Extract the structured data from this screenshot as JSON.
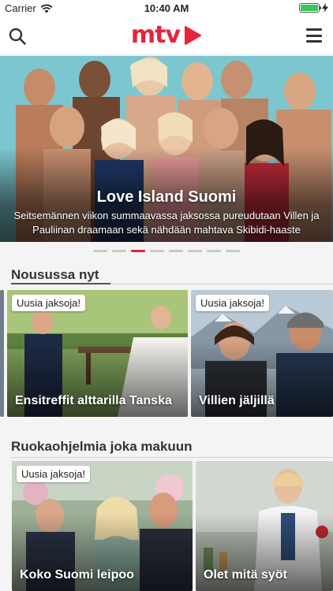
{
  "status_bar": {
    "carrier": "Carrier",
    "time": "10:40 AM"
  },
  "nav": {
    "logo_text": "mtv",
    "brand_color": "#e5243b"
  },
  "hero": {
    "title": "Love Island Suomi",
    "description": "Seitsemännen viikon summaavassa jaksossa pureudutaan Villen ja Pauliinan draamaan sekä nähdään mahtava Skibidi-haaste",
    "page_count": 8,
    "active_page": 3
  },
  "sections": [
    {
      "title": "Nousussa nyt",
      "cards": [
        {
          "badge": "Uusia jaksoja!",
          "title": "Ensitreffit alttarilla Tanska"
        },
        {
          "badge": "Uusia jaksoja!",
          "title": "Villien jäljillä"
        }
      ]
    },
    {
      "title": "Ruokaohjelmia joka makuun",
      "cards": [
        {
          "badge": "Uusia jaksoja!",
          "title": "Koko Suomi leipoo"
        },
        {
          "badge": "",
          "title": "Olet mitä syöt"
        }
      ]
    }
  ]
}
